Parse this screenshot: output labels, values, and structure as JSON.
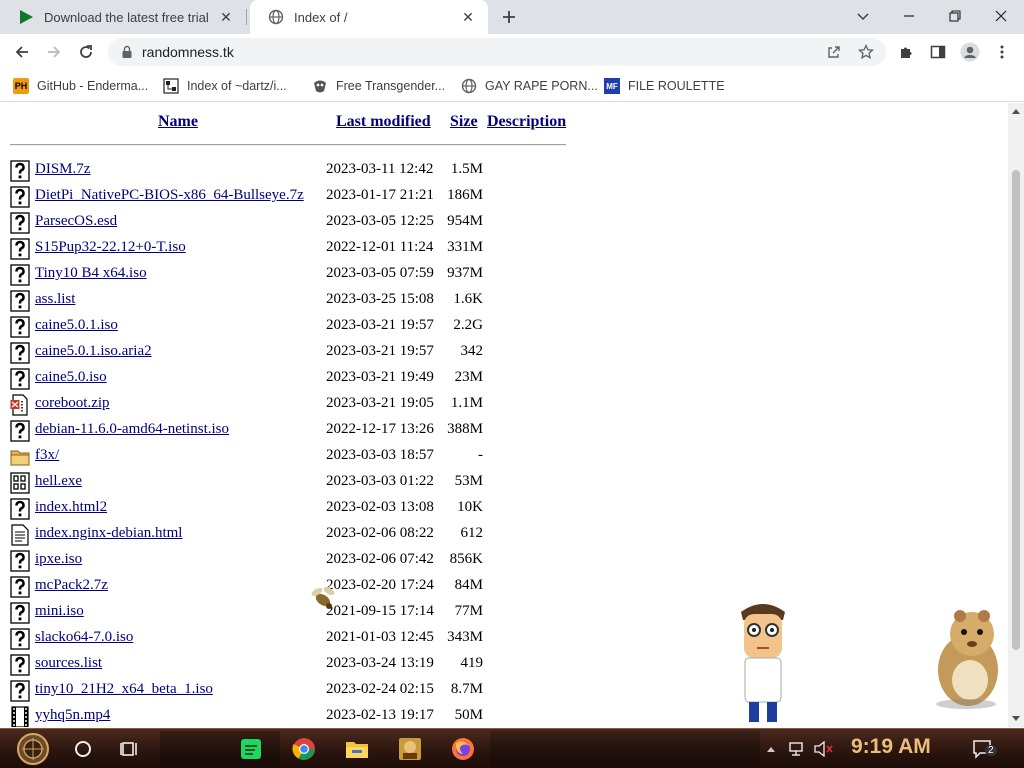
{
  "browser": {
    "tabs": [
      {
        "title": "Download the latest free trial",
        "active": false
      },
      {
        "title": "Index of /",
        "active": true
      }
    ],
    "url": "randomness.tk",
    "bookmarks": [
      {
        "label": "GitHub - Enderma..."
      },
      {
        "label": "Index of ~dartz/i..."
      },
      {
        "label": "Free Transgender..."
      },
      {
        "label": "GAY RAPE PORN..."
      },
      {
        "label": "FILE ROULETTE"
      }
    ]
  },
  "listing": {
    "headers": {
      "name": "Name",
      "modified": "Last modified",
      "size": "Size",
      "description": "Description"
    },
    "rows": [
      {
        "name": "DISM.7z",
        "date": "2023-03-11 12:42",
        "size": "1.5M",
        "icon": "unknown-file-icon"
      },
      {
        "name": "DietPi_NativePC-BIOS-x86_64-Bullseye.7z",
        "date": "2023-01-17 21:21",
        "size": "186M",
        "icon": "unknown-file-icon"
      },
      {
        "name": "ParsecOS.esd",
        "date": "2023-03-05 12:25",
        "size": "954M",
        "icon": "unknown-file-icon"
      },
      {
        "name": "S15Pup32-22.12+0-T.iso",
        "date": "2022-12-01 11:24",
        "size": "331M",
        "icon": "unknown-file-icon"
      },
      {
        "name": "Tiny10 B4 x64.iso",
        "date": "2023-03-05 07:59",
        "size": "937M",
        "icon": "unknown-file-icon"
      },
      {
        "name": "ass.list",
        "date": "2023-03-25 15:08",
        "size": "1.6K",
        "icon": "unknown-file-icon"
      },
      {
        "name": "caine5.0.1.iso",
        "date": "2023-03-21 19:57",
        "size": "2.2G",
        "icon": "unknown-file-icon"
      },
      {
        "name": "caine5.0.1.iso.aria2",
        "date": "2023-03-21 19:57",
        "size": "342",
        "icon": "unknown-file-icon"
      },
      {
        "name": "caine5.0.iso",
        "date": "2023-03-21 19:49",
        "size": "23M",
        "icon": "unknown-file-icon"
      },
      {
        "name": "coreboot.zip",
        "date": "2023-03-21 19:05",
        "size": "1.1M",
        "icon": "compressed-file-icon"
      },
      {
        "name": "debian-11.6.0-amd64-netinst.iso",
        "date": "2022-12-17 13:26",
        "size": "388M",
        "icon": "unknown-file-icon"
      },
      {
        "name": "f3x/",
        "date": "2023-03-03 18:57",
        "size": "-",
        "icon": "folder-icon"
      },
      {
        "name": "hell.exe",
        "date": "2023-03-03 01:22",
        "size": "53M",
        "icon": "binary-file-icon"
      },
      {
        "name": "index.html2",
        "date": "2023-02-03 13:08",
        "size": "10K",
        "icon": "unknown-file-icon"
      },
      {
        "name": "index.nginx-debian.html",
        "date": "2023-02-06 08:22",
        "size": "612",
        "icon": "text-file-icon"
      },
      {
        "name": "ipxe.iso",
        "date": "2023-02-06 07:42",
        "size": "856K",
        "icon": "unknown-file-icon"
      },
      {
        "name": "mcPack2.7z",
        "date": "2023-02-20 17:24",
        "size": "84M",
        "icon": "unknown-file-icon"
      },
      {
        "name": "mini.iso",
        "date": "2021-09-15 17:14",
        "size": "77M",
        "icon": "unknown-file-icon"
      },
      {
        "name": "slacko64-7.0.iso",
        "date": "2021-01-03 12:45",
        "size": "343M",
        "icon": "unknown-file-icon"
      },
      {
        "name": "sources.list",
        "date": "2023-03-24 13:19",
        "size": "419",
        "icon": "unknown-file-icon"
      },
      {
        "name": "tiny10_21H2_x64_beta_1.iso",
        "date": "2023-02-24 02:15",
        "size": "8.7M",
        "icon": "unknown-file-icon"
      },
      {
        "name": "yyhq5n.mp4",
        "date": "2023-02-13 19:17",
        "size": "50M",
        "icon": "movie-file-icon"
      }
    ]
  },
  "taskbar": {
    "time": "9:19 AM",
    "notification_count": "2",
    "pinned": [
      "start-button",
      "cortana-button",
      "task-view-button",
      "spotify-app",
      "chrome-app",
      "file-explorer-app",
      "game-app",
      "firefox-app"
    ]
  },
  "colors": {
    "link": "#00007f",
    "tabstrip": "#dee1e6",
    "taskbar": "#2a140e",
    "clock": "#e8c07a"
  }
}
